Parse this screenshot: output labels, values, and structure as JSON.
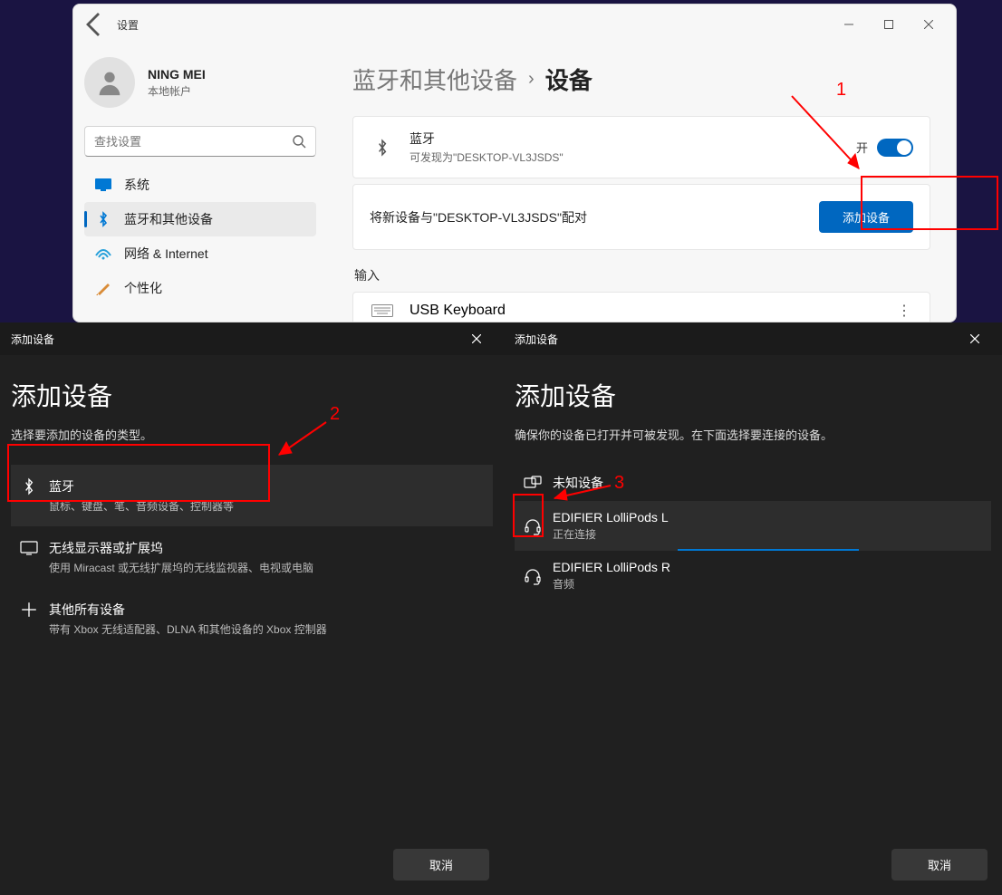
{
  "annotations": {
    "n1": "1",
    "n2": "2",
    "n3": "3"
  },
  "settings": {
    "window_title": "设置",
    "user": {
      "name": "NING MEI",
      "account_type": "本地帐户"
    },
    "search_placeholder": "查找设置",
    "nav": {
      "system": "系统",
      "bluetooth": "蓝牙和其他设备",
      "network": "网络 & Internet",
      "personal": "个性化"
    },
    "breadcrumb": {
      "section": "蓝牙和其他设备",
      "page": "设备"
    },
    "bt_card": {
      "title": "蓝牙",
      "subtitle": "可发现为\"DESKTOP-VL3JSDS\"",
      "toggle_label": "开"
    },
    "pair_card": {
      "text": "将新设备与\"DESKTOP-VL3JSDS\"配对",
      "button": "添加设备"
    },
    "input_section": "输入",
    "usb_keyboard": "USB Keyboard"
  },
  "popup1": {
    "titlebar": "添加设备",
    "heading": "添加设备",
    "hint": "选择要添加的设备的类型。",
    "opt_bt": {
      "title": "蓝牙",
      "sub": "鼠标、键盘、笔、音频设备、控制器等"
    },
    "opt_display": {
      "title": "无线显示器或扩展坞",
      "sub": "使用 Miracast 或无线扩展坞的无线监视器、电视或电脑"
    },
    "opt_other": {
      "title": "其他所有设备",
      "sub": "带有 Xbox 无线适配器、DLNA 和其他设备的 Xbox 控制器"
    },
    "cancel": "取消"
  },
  "popup2": {
    "titlebar": "添加设备",
    "heading": "添加设备",
    "hint": "确保你的设备已打开并可被发现。在下面选择要连接的设备。",
    "unknown": "未知设备",
    "dev1": {
      "name": "EDIFIER LolliPods L",
      "status": "正在连接"
    },
    "dev2": {
      "name": "EDIFIER LolliPods R",
      "status": "音频"
    },
    "cancel": "取消"
  }
}
